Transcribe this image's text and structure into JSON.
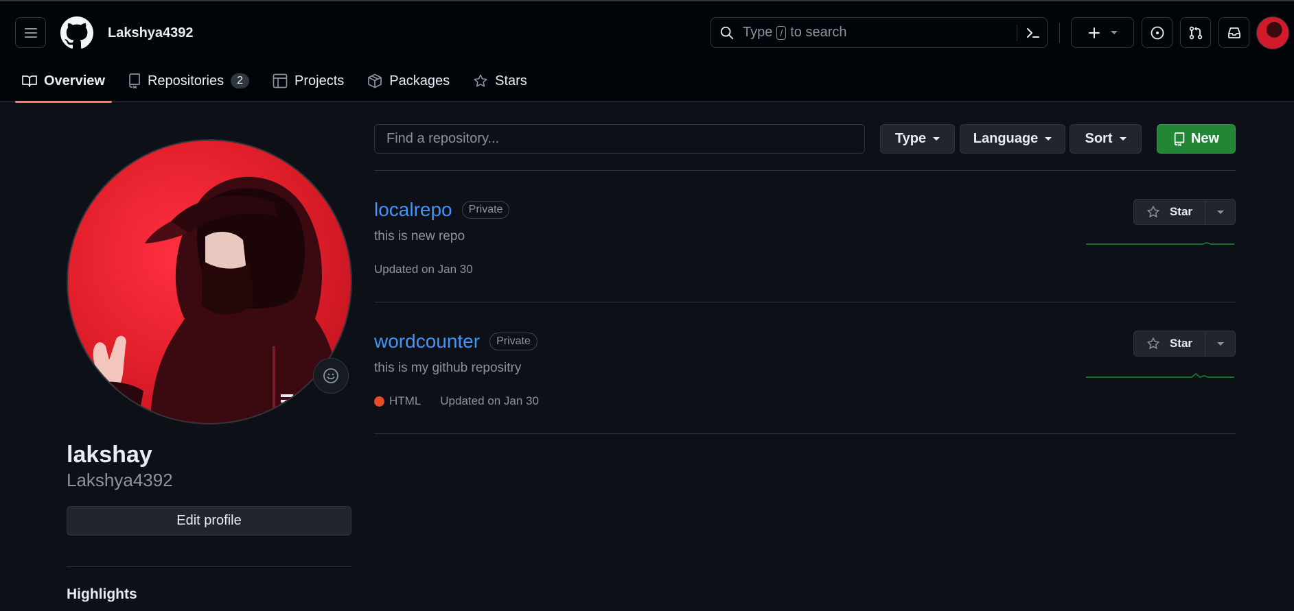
{
  "header": {
    "username": "Lakshya4392",
    "search_prefix": "Type",
    "search_key": "/",
    "search_suffix": "to search"
  },
  "tabs": [
    {
      "label": "Overview",
      "active": true,
      "icon": "book-icon"
    },
    {
      "label": "Repositories",
      "count": "2",
      "icon": "repo-icon"
    },
    {
      "label": "Projects",
      "icon": "table-icon"
    },
    {
      "label": "Packages",
      "icon": "package-icon"
    },
    {
      "label": "Stars",
      "icon": "star-icon"
    }
  ],
  "profile": {
    "display_name": "lakshay",
    "login": "Lakshya4392",
    "edit_label": "Edit profile",
    "highlights_label": "Highlights"
  },
  "filters": {
    "find_placeholder": "Find a repository...",
    "type_label": "Type",
    "language_label": "Language",
    "sort_label": "Sort",
    "new_label": "New"
  },
  "repos": [
    {
      "name": "localrepo",
      "visibility": "Private",
      "description": "this is new repo",
      "updated": "Updated on Jan 30",
      "star_label": "Star"
    },
    {
      "name": "wordcounter",
      "visibility": "Private",
      "description": "this is my github repositry",
      "language": "HTML",
      "updated": "Updated on Jan 30",
      "star_label": "Star"
    }
  ],
  "colors": {
    "accent_link": "#4493f8",
    "tab_underline": "#f78166",
    "new_button": "#238636",
    "html_language": "#e34c26"
  }
}
